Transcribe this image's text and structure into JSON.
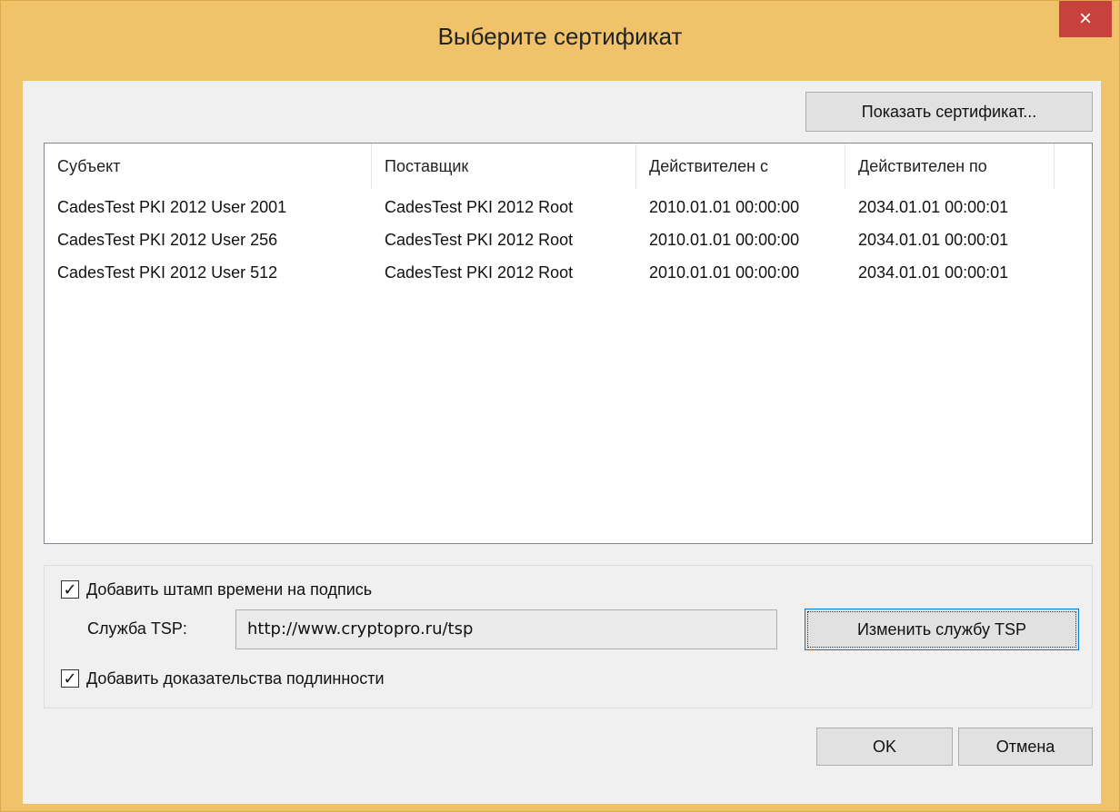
{
  "window": {
    "title": "Выберите сертификат",
    "close_glyph": "×"
  },
  "buttons": {
    "show_certificate": "Показать сертификат...",
    "change_tsp": "Изменить службу TSP",
    "ok": "OK",
    "cancel": "Отмена"
  },
  "table": {
    "headers": [
      "Субъект",
      "Поставщик",
      "Действителен с",
      "Действителен по"
    ],
    "rows": [
      [
        "CadesTest PKI 2012 User 2001",
        "CadesTest PKI 2012 Root",
        "2010.01.01 00:00:00",
        "2034.01.01 00:00:01"
      ],
      [
        "CadesTest PKI 2012 User 256",
        "CadesTest PKI 2012 Root",
        "2010.01.01 00:00:00",
        "2034.01.01 00:00:01"
      ],
      [
        "CadesTest PKI 2012 User 512",
        "CadesTest PKI 2012 Root",
        "2010.01.01 00:00:00",
        "2034.01.01 00:00:01"
      ]
    ]
  },
  "options": {
    "add_timestamp": {
      "label": "Добавить штамп времени на подпись",
      "checked": true
    },
    "tsp_label": "Служба TSP:",
    "tsp_value": "http://www.cryptopro.ru/tsp",
    "add_evidence": {
      "label": "Добавить доказательства подлинности",
      "checked": true
    }
  },
  "colors": {
    "title_bar": "#f0c36b",
    "close_button": "#c7413d",
    "client_bg": "#f0f0f0"
  }
}
